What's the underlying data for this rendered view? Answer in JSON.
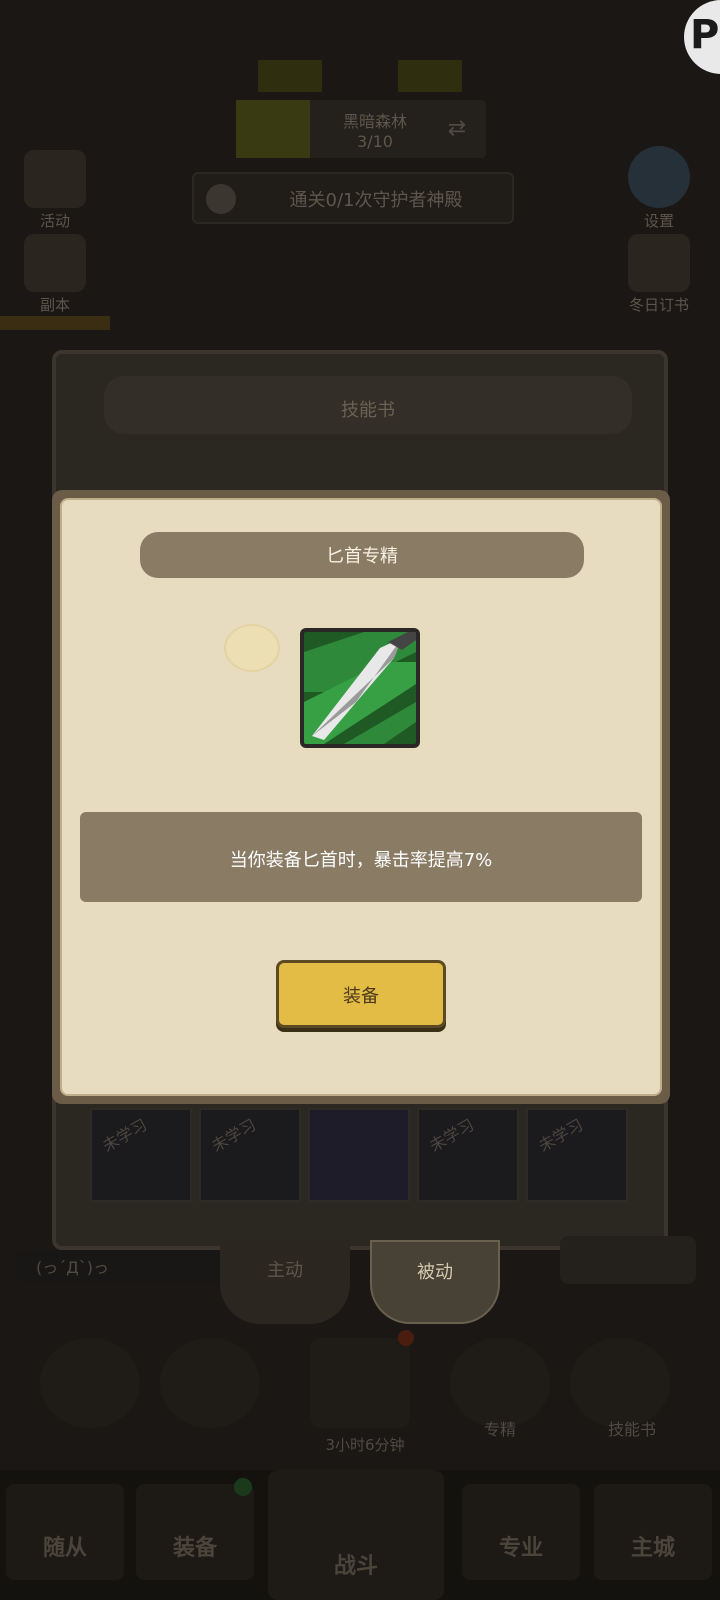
{
  "background_screen": {
    "stage": {
      "name": "黑暗森林",
      "progress": "3/10"
    },
    "quest_text": "通关0/1次守护者神殿",
    "left_menu": [
      {
        "label": "活动",
        "icon": "event-chest-icon"
      },
      {
        "label": "副本",
        "icon": "dungeon-icon"
      }
    ],
    "right_menu": [
      {
        "label": "设置",
        "icon": "gear-icon"
      },
      {
        "label": "冬日订书",
        "icon": "book-icon"
      }
    ],
    "speech_text": "(っ´Д`)っ",
    "tabs": {
      "active_label": "主动",
      "passive_label": "被动"
    },
    "skill_actions": [
      {
        "label": "专精",
        "icon": "mastery-icon"
      },
      {
        "label": "技能书",
        "icon": "skill-book-icon"
      }
    ],
    "timer_text": "3小时6分钟",
    "bottom_nav": {
      "left_items": [
        "随从",
        "装备"
      ],
      "center_item": "战斗",
      "right_items": [
        "专业",
        "主城"
      ]
    }
  },
  "skill_book_panel": {
    "title": "技能书",
    "slots": [
      {
        "status": "未学习",
        "icon": "crossed-swords-icon"
      },
      {
        "status": "未学习",
        "icon": "hooded-figure-icon"
      },
      {
        "status": "",
        "icon": "demon-mask-icon"
      },
      {
        "status": "未学习",
        "icon": "beast-icon"
      },
      {
        "status": "未学习",
        "icon": "dark-creature-icon"
      }
    ]
  },
  "dialog": {
    "title": "匕首专精",
    "skill_icon": "dagger-icon",
    "description": "当你装备匕首时，暴击率提高7%",
    "equip_button": "装备"
  },
  "corner_badge": {
    "glyph": "P"
  },
  "colors": {
    "parchment": "#e7dcbf",
    "band": "#8a7b65",
    "button_gold": "#e3bc45",
    "icon_green": "#2e8a3a"
  }
}
